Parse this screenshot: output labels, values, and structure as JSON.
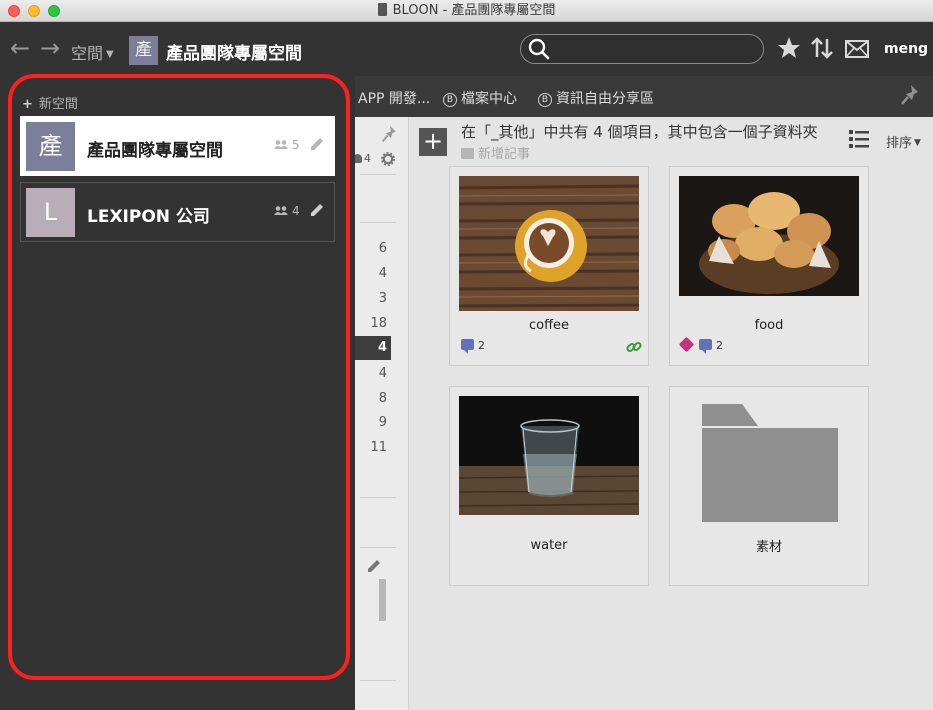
{
  "window": {
    "title": "BLOON - 產品團隊專屬空間"
  },
  "toolbar": {
    "back_icon": "arrow-left-icon",
    "forward_icon": "arrow-right-icon",
    "space_menu_label": "空間",
    "current_space_avatar": "產",
    "current_space_title": "產品團隊專屬空間",
    "search_placeholder": "",
    "user_name": "meng"
  },
  "tabs": [
    {
      "label": "APP 開發..."
    },
    {
      "label": "檔案中心",
      "badge": "B"
    },
    {
      "label": "資訊自由分享區",
      "badge": "B"
    }
  ],
  "sidebar": {
    "new_space_label": "新空間",
    "spaces": [
      {
        "avatar": "產",
        "name": "產品團隊專屬空間",
        "members": "5",
        "avatar_color": "#7d7e9a",
        "selected": true
      },
      {
        "avatar": "L",
        "name": "LEXIPON 公司",
        "members": "4",
        "avatar_color": "#b9adb7",
        "selected": false
      }
    ]
  },
  "midcol": {
    "member_count": "4",
    "counts": [
      "6",
      "4",
      "3",
      "18",
      "4",
      "4",
      "8",
      "9",
      "11"
    ],
    "active_index": 4
  },
  "main": {
    "headline": "在「_其他」中共有 4 個項目，其中包含一個子資料夾",
    "new_note_label": "新增記事",
    "sort_label": "排序",
    "cards": [
      {
        "label": "coffee",
        "comments": "2",
        "has_link": true
      },
      {
        "label": "food",
        "comments": "2",
        "has_tag": true
      },
      {
        "label": "water"
      },
      {
        "label": "素材",
        "is_folder": true
      }
    ]
  },
  "colors": {
    "highlight": "#ff1f1f",
    "toolbar_bg": "#333333",
    "comment_icon": "#6072b8",
    "tag_icon": "#c5317d",
    "link_icon": "#3a9a3a"
  }
}
